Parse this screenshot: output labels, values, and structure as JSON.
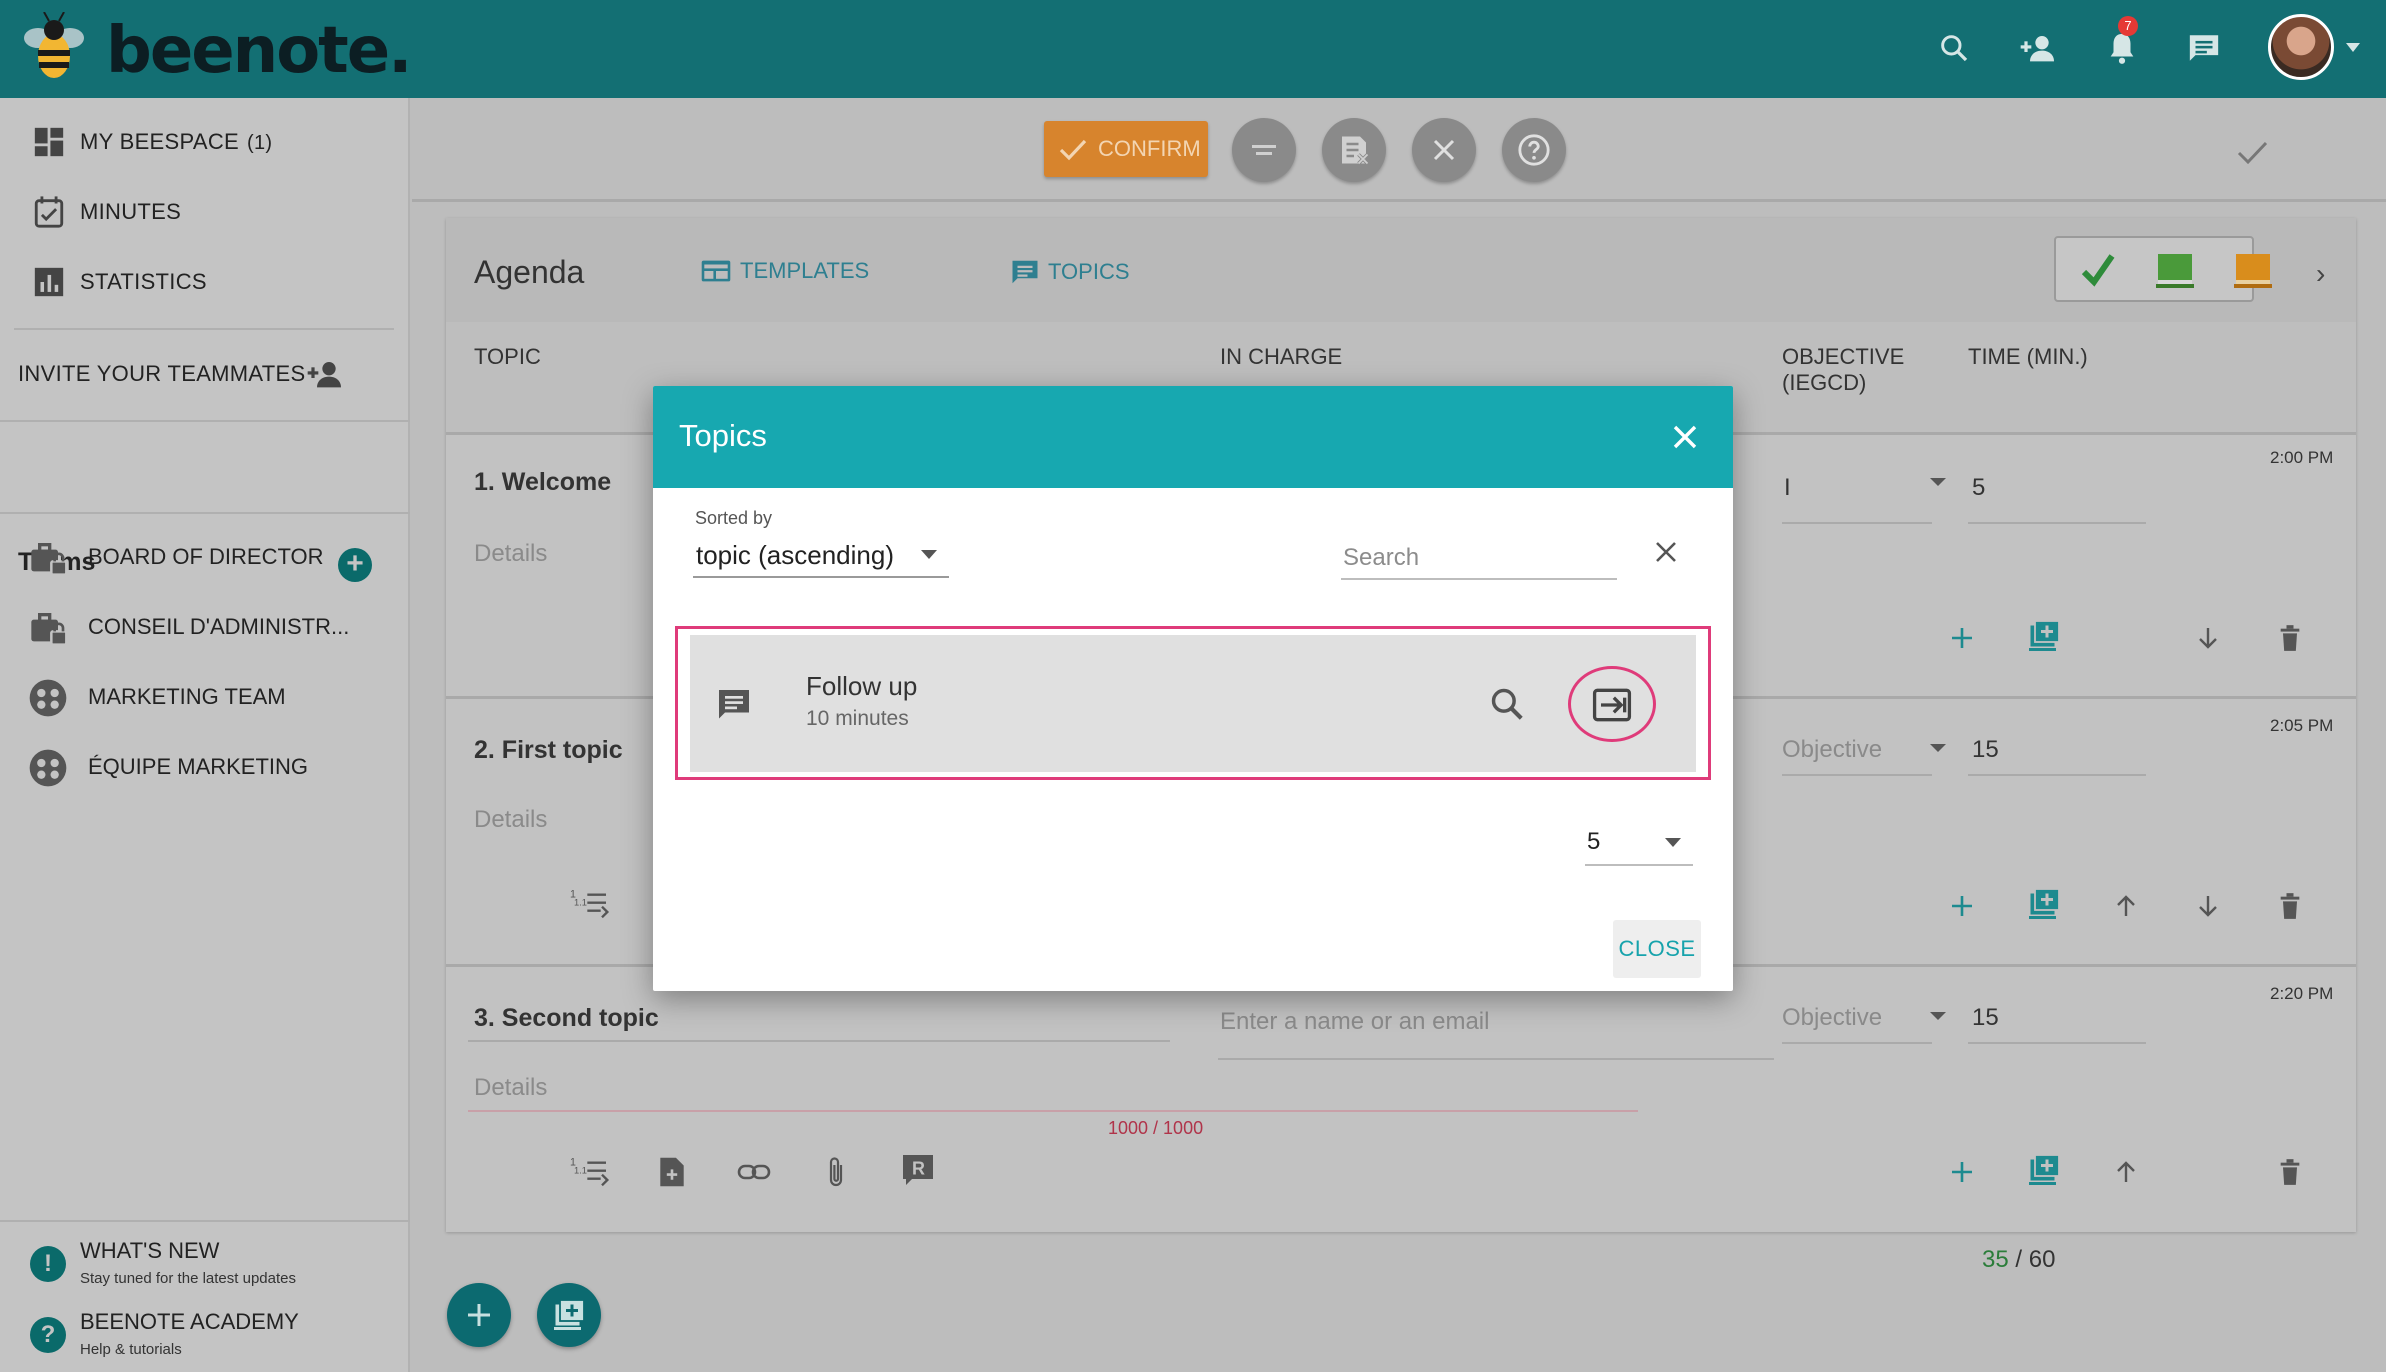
{
  "app": {
    "brand": "beenote."
  },
  "topbar": {
    "icons": [
      "search-icon",
      "add-user-icon",
      "bell-icon",
      "chat-icon"
    ],
    "notification_count": "7"
  },
  "sidebar": {
    "items": [
      {
        "label": "MY BEESPACE",
        "count": "(1)",
        "icon": "dashboard-icon"
      },
      {
        "label": "MINUTES",
        "icon": "calendar-check-icon"
      },
      {
        "label": "STATISTICS",
        "icon": "bar-chart-icon"
      }
    ],
    "invite_label": "INVITE YOUR TEAMMATES",
    "teams_title": "Teams",
    "teams": [
      {
        "label": "BOARD OF DIRECTOR",
        "icon": "briefcase-lock-icon"
      },
      {
        "label": "CONSEIL D'ADMINISTR...",
        "icon": "briefcase-lock-icon"
      },
      {
        "label": "MARKETING TEAM",
        "icon": "team-icon"
      },
      {
        "label": "ÉQUIPE MARKETING",
        "icon": "team-icon"
      }
    ],
    "footer": [
      {
        "title": "WHAT'S NEW",
        "subtitle": "Stay tuned for the latest updates",
        "icon": "!"
      },
      {
        "title": "BEENOTE ACADEMY",
        "subtitle": "Help & tutorials",
        "icon": "?"
      }
    ]
  },
  "actionbar": {
    "confirm_label": "CONFIRM"
  },
  "agenda": {
    "title": "Agenda",
    "tabs": [
      {
        "label": "TEMPLATES"
      },
      {
        "label": "TOPICS"
      }
    ],
    "columns": {
      "topic": "TOPIC",
      "in_charge": "IN CHARGE",
      "objective": "OBJECTIVE (IEGCD)",
      "time": "TIME (MIN.)"
    },
    "rows": [
      {
        "title": "1. Welcome",
        "details_placeholder": "Details",
        "objective": "I",
        "time": "5",
        "start": "2:00 PM"
      },
      {
        "title": "2. First topic",
        "details_placeholder": "Details",
        "objective_placeholder": "Objective",
        "time": "15",
        "start": "2:05 PM"
      },
      {
        "title": "3. Second topic",
        "details_placeholder": "Details",
        "in_charge_placeholder": "Enter a name or an email",
        "objective_placeholder": "Objective",
        "time": "15",
        "start": "2:20 PM",
        "counter": "1000 / 1000"
      }
    ],
    "total_used": "35",
    "total_sep": " / ",
    "total_max": "60"
  },
  "modal": {
    "title": "Topics",
    "sorted_by_label": "Sorted by",
    "sorted_by_value": "topic (ascending)",
    "search_placeholder": "Search",
    "results": [
      {
        "name": "Follow up",
        "duration": "10 minutes"
      }
    ],
    "per_page": "5",
    "close_label": "CLOSE",
    "accent": "#17a8b0",
    "highlight": "#df3b7a"
  }
}
